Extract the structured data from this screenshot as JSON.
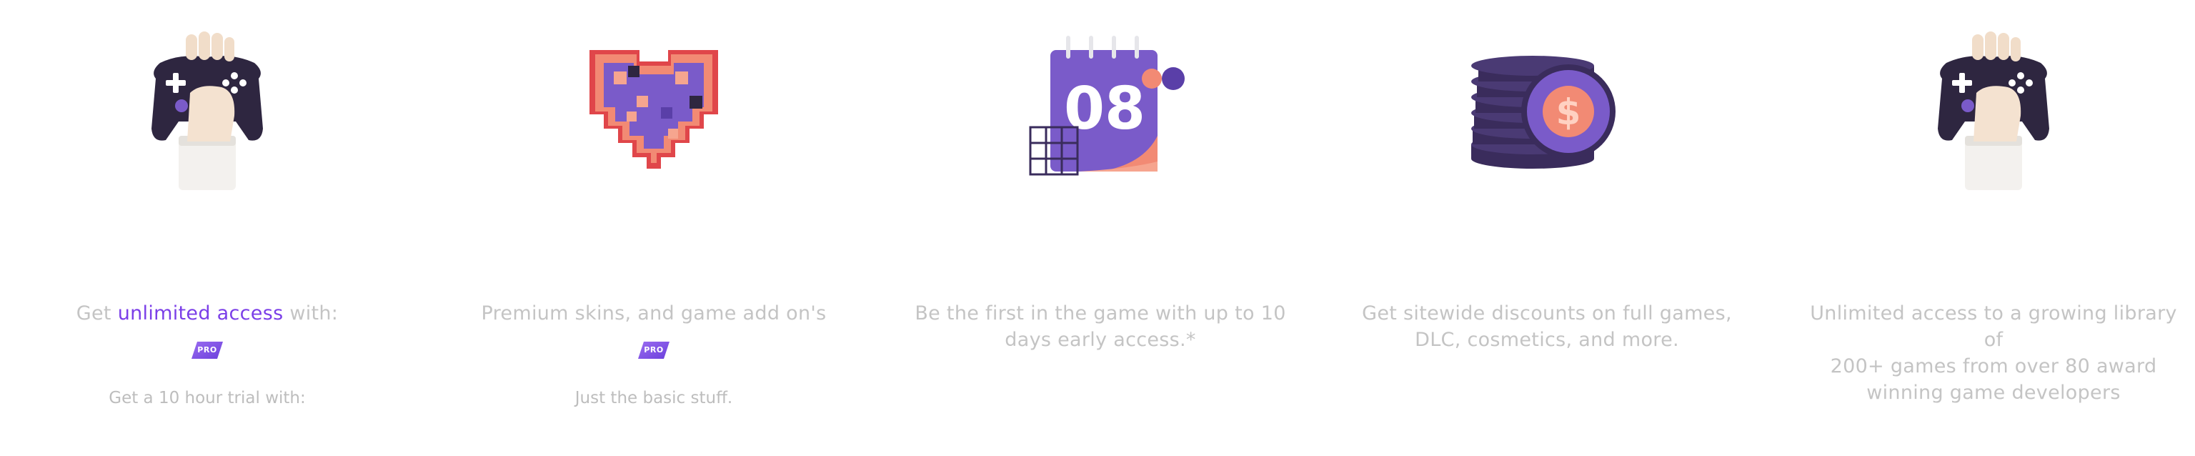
{
  "colors": {
    "accent": "#7b3fe8",
    "muted_text": "#c4c4c4",
    "purple": "#7a5bc9",
    "dark_purple": "#3a2c5c",
    "coral": "#f28a74",
    "red": "#e0464a"
  },
  "features": [
    {
      "icon": "game-controller-hand-icon",
      "desc_prefix": "Get ",
      "desc_accent": "unlimited access",
      "desc_suffix": " with:",
      "badge": "PRO",
      "sub": "Get a 10 hour trial with:"
    },
    {
      "icon": "pixel-heart-icon",
      "desc": "Premium skins, and game add on's",
      "badge": "PRO",
      "sub": "Just the basic stuff."
    },
    {
      "icon": "calendar-08-icon",
      "calendar_number": "08",
      "desc_line1": "Be the first in the game with up to 10",
      "desc_line2": "days early access.*"
    },
    {
      "icon": "coin-stack-icon",
      "coin_symbol": "$",
      "desc_line1": "Get sitewide discounts on full games,",
      "desc_line2": "DLC, cosmetics, and more."
    },
    {
      "icon": "game-controller-hand-icon",
      "desc_line1": "Unlimited access to a growing library of",
      "desc_line2": "200+ games from over 80 award",
      "desc_line3": "winning game developers"
    }
  ]
}
